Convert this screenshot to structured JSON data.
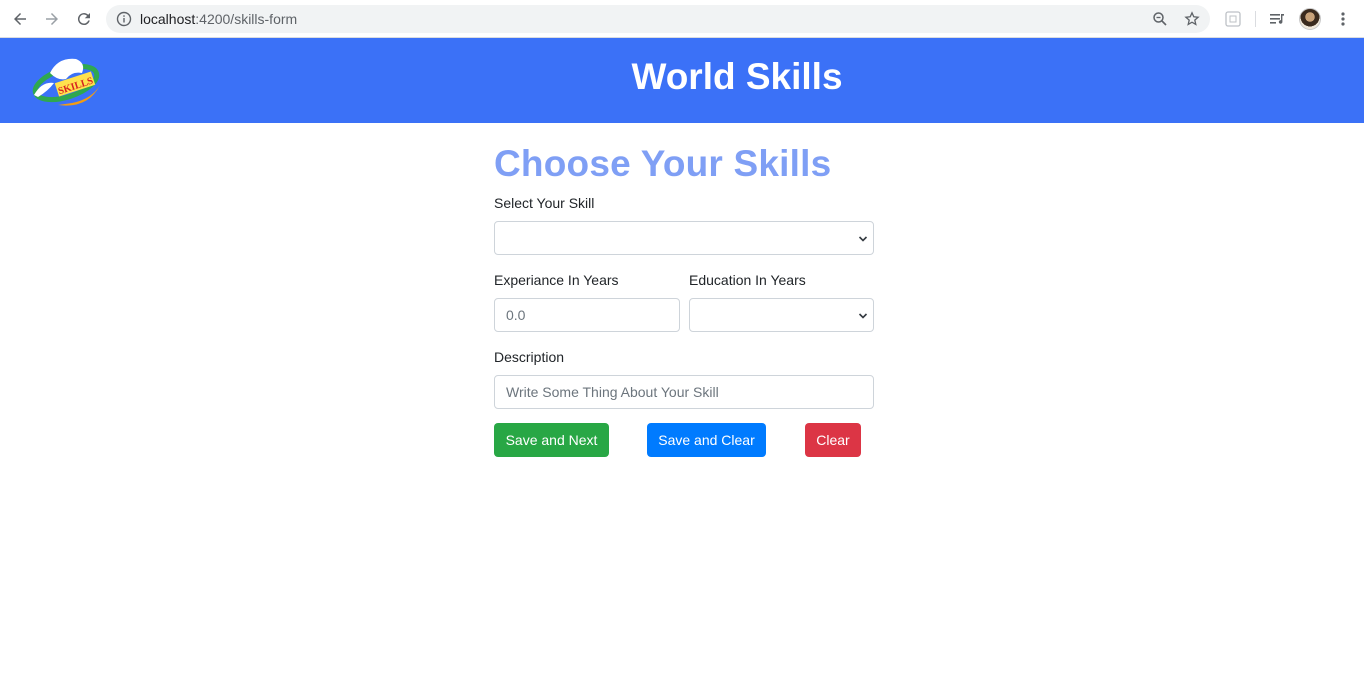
{
  "browser": {
    "url_host": "localhost",
    "url_path": ":4200/skills-form"
  },
  "header": {
    "title": "World Skills",
    "logo_text": "SKILLS"
  },
  "form": {
    "title": "Choose Your Skills",
    "skill_label": "Select Your Skill",
    "skill_value": "",
    "experience_label": "Experiance In Years",
    "experience_placeholder": "0.0",
    "education_label": "Education In Years",
    "education_value": "",
    "description_label": "Description",
    "description_placeholder": "Write Some Thing About Your Skill",
    "buttons": {
      "save_next": "Save and Next",
      "save_clear": "Save and Clear",
      "clear": "Clear"
    }
  },
  "colors": {
    "header_bg": "#3b71f7",
    "title": "#7f9ff5",
    "save_next": "#28a745",
    "save_clear": "#007bff",
    "clear": "#dc3545"
  }
}
